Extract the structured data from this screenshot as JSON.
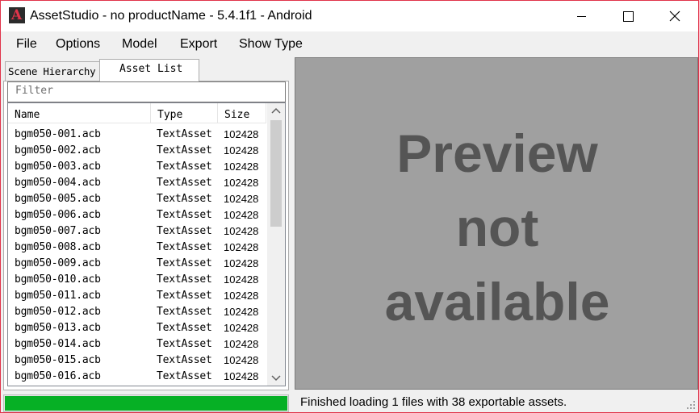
{
  "window": {
    "title": "AssetStudio - no productName - 5.4.1f1 - Android",
    "app_icon_letter": "A",
    "accent_color": "#e0344a"
  },
  "menu": [
    "File",
    "Options",
    "Model",
    "Export",
    "Show Type"
  ],
  "tabs": {
    "scene": "Scene Hierarchy",
    "asset": "Asset List",
    "active": "Asset List"
  },
  "filter": {
    "placeholder": "Filter",
    "value": ""
  },
  "list": {
    "columns": [
      "Name",
      "Type",
      "Size"
    ],
    "rows": [
      [
        "bgm050-001.acb",
        "TextAsset",
        "102428"
      ],
      [
        "bgm050-002.acb",
        "TextAsset",
        "102428"
      ],
      [
        "bgm050-003.acb",
        "TextAsset",
        "102428"
      ],
      [
        "bgm050-004.acb",
        "TextAsset",
        "102428"
      ],
      [
        "bgm050-005.acb",
        "TextAsset",
        "102428"
      ],
      [
        "bgm050-006.acb",
        "TextAsset",
        "102428"
      ],
      [
        "bgm050-007.acb",
        "TextAsset",
        "102428"
      ],
      [
        "bgm050-008.acb",
        "TextAsset",
        "102428"
      ],
      [
        "bgm050-009.acb",
        "TextAsset",
        "102428"
      ],
      [
        "bgm050-010.acb",
        "TextAsset",
        "102428"
      ],
      [
        "bgm050-011.acb",
        "TextAsset",
        "102428"
      ],
      [
        "bgm050-012.acb",
        "TextAsset",
        "102428"
      ],
      [
        "bgm050-013.acb",
        "TextAsset",
        "102428"
      ],
      [
        "bgm050-014.acb",
        "TextAsset",
        "102428"
      ],
      [
        "bgm050-015.acb",
        "TextAsset",
        "102428"
      ],
      [
        "bgm050-016.acb",
        "TextAsset",
        "102428"
      ]
    ]
  },
  "progress": {
    "fraction": 1.0,
    "color": "#06b025"
  },
  "preview": {
    "lines": [
      "Preview",
      "not",
      "available"
    ],
    "background": "#a0a0a0",
    "text_color": "#555555"
  },
  "status": {
    "text": "Finished loading 1 files with 38 exportable assets."
  },
  "icons": {
    "minimize": "minimize-icon",
    "maximize": "maximize-icon",
    "close": "close-icon",
    "scroll_up": "chevron-up-icon",
    "scroll_down": "chevron-down-icon",
    "grip": "size-grip-icon"
  }
}
